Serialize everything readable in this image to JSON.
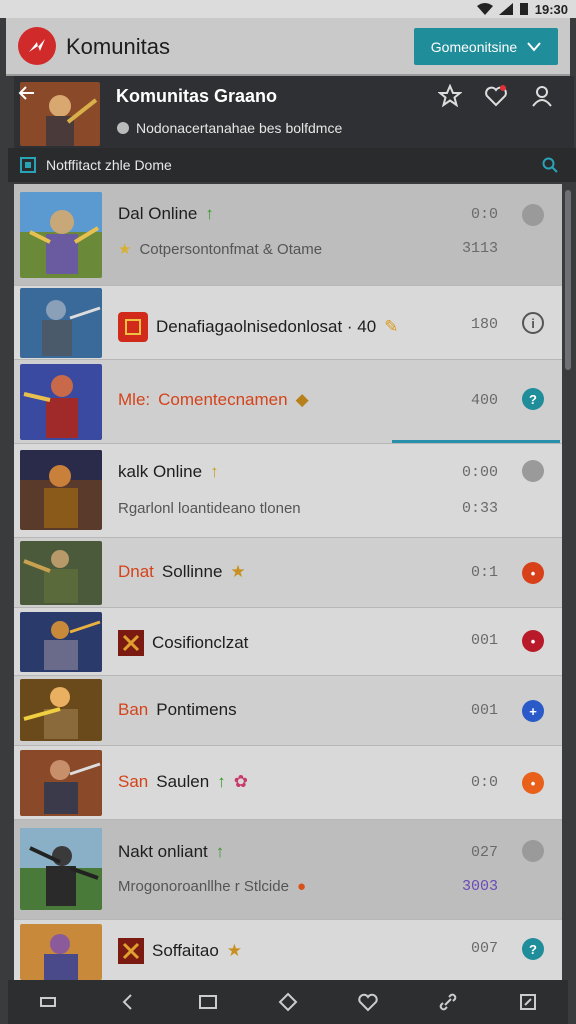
{
  "status": {
    "time": "19:30"
  },
  "app": {
    "title": "Komunitas",
    "header_button": "Gomeonitsine",
    "brand_color": "#d12a2a",
    "accent_color": "#1f8d9a"
  },
  "game": {
    "title": "Komunitas Graano",
    "subtitle": "Nodonacertanahae bes bolfdmce",
    "actions": [
      "star-icon",
      "heart-icon",
      "user-icon"
    ]
  },
  "notification": {
    "text": "Notffitact zhle Dome"
  },
  "items": [
    {
      "line1": "Dal Online",
      "line1_badge": "↑",
      "line2": "Cotpersontonfmat & Otame",
      "count1": "0:0",
      "count2": "3113",
      "status": "gray"
    },
    {
      "line1": "Denafiagaolnisedonlosat · 40",
      "count1": "180",
      "status": "outline"
    },
    {
      "prefix": "Mle:",
      "line1": "Comentecnamen",
      "count1": "400",
      "status": "teal",
      "progress": 0.3
    },
    {
      "line1": "kalk Online",
      "line1_badge": "↑",
      "line2": "Rgarlonl loantideano tlonen",
      "count1": "0:00",
      "count2": "0:33",
      "status": "gray"
    },
    {
      "prefix": "Dnat",
      "line1": "Sollinne",
      "count1": "0:1",
      "status": "red"
    },
    {
      "line1": "Cosifionclzat",
      "count1": "001",
      "status": "darkred"
    },
    {
      "prefix": "Ban",
      "line1": "Pontimens",
      "count1": "001",
      "status": "blue"
    },
    {
      "prefix": "San",
      "line1": "Saulen",
      "line1_badge": "↑",
      "count1": "0:0",
      "status": "orange"
    },
    {
      "line1": "Nakt onliant",
      "line1_badge": "↑",
      "line2": "Mrogonoroanllhe r Stlcide",
      "count1": "027",
      "count2": "3003",
      "status": "gray"
    },
    {
      "line1": "Soffaitao",
      "count1": "007",
      "status": "teal"
    }
  ],
  "nav": [
    "menu-icon",
    "back-icon",
    "square-icon",
    "home-icon",
    "heart-icon",
    "link-icon",
    "expand-icon"
  ]
}
